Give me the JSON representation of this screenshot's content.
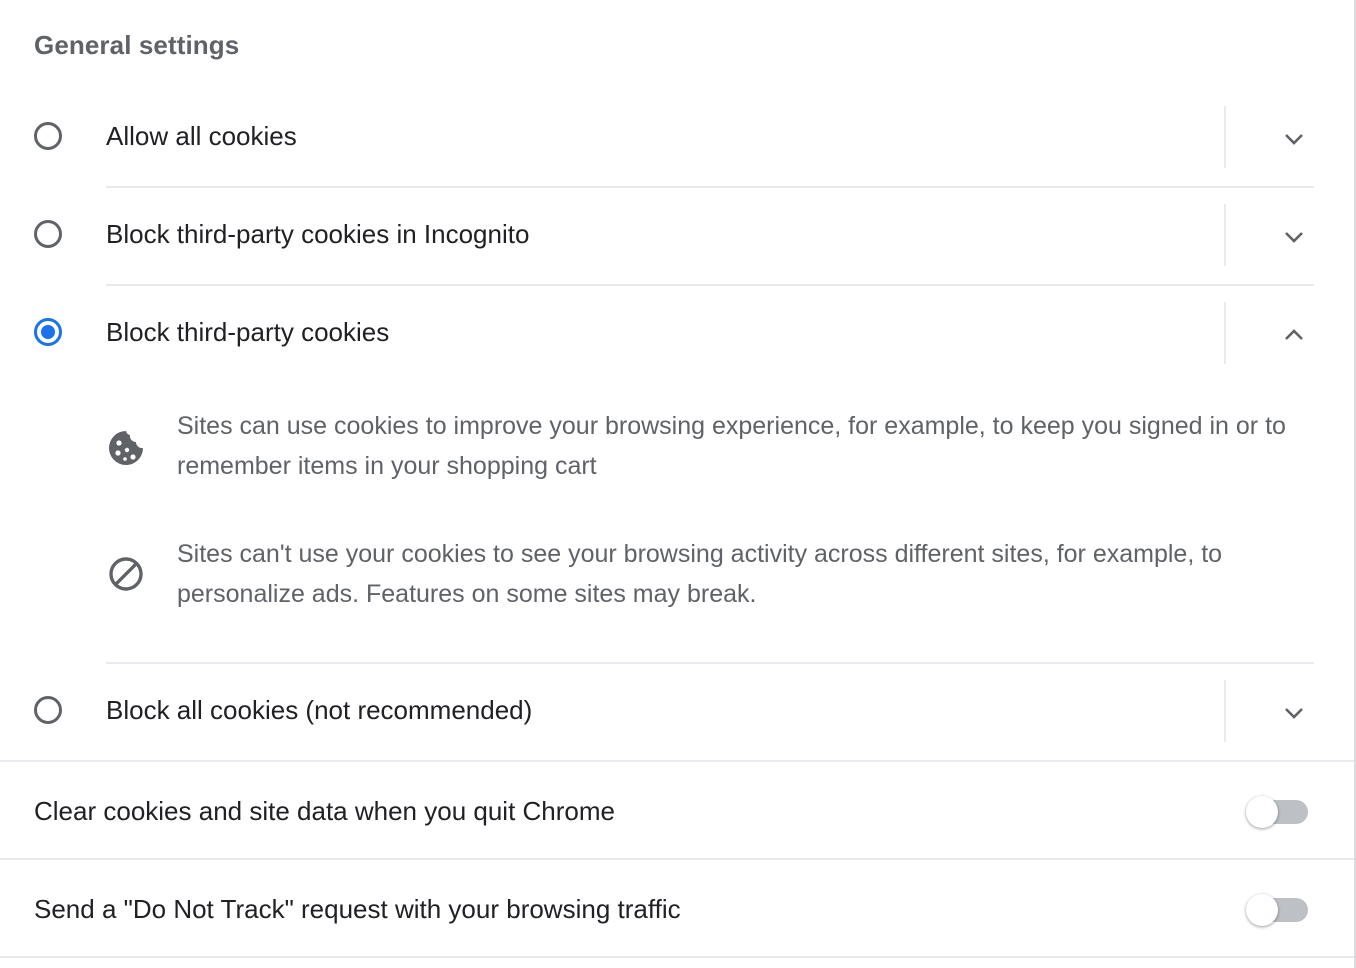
{
  "section_title": "General settings",
  "cookie_options": [
    {
      "label": "Allow all cookies",
      "selected": false,
      "expanded": false
    },
    {
      "label": "Block third-party cookies in Incognito",
      "selected": false,
      "expanded": false
    },
    {
      "label": "Block third-party cookies",
      "selected": true,
      "expanded": true
    },
    {
      "label": "Block all cookies (not recommended)",
      "selected": false,
      "expanded": false
    }
  ],
  "expanded_details": [
    {
      "icon": "cookie-icon",
      "text": "Sites can use cookies to improve your browsing experience, for example, to keep you signed in or to remember items in your shopping cart"
    },
    {
      "icon": "block-icon",
      "text": "Sites can't use your cookies to see your browsing activity across different sites, for example, to personalize ads. Features on some sites may break."
    }
  ],
  "toggles": [
    {
      "label": "Clear cookies and site data when you quit Chrome",
      "on": false
    },
    {
      "label": "Send a \"Do Not Track\" request with your browsing traffic",
      "on": false
    }
  ],
  "colors": {
    "accent": "#1a73e8",
    "primary_text": "#202124",
    "secondary_text": "#5f6368",
    "divider": "#e8eaed",
    "toggle_off_track": "#bdc1c6"
  }
}
